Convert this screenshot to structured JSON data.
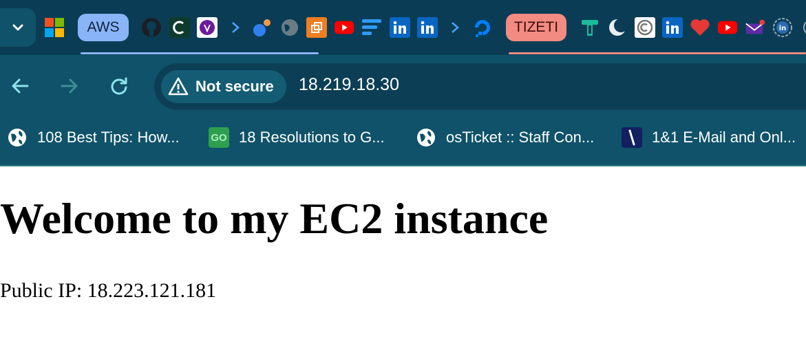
{
  "browser": {
    "tab_groups": [
      {
        "label": "AWS",
        "color": "#8ab4f8"
      },
      {
        "label": "TIZETI",
        "color": "#f28b82"
      }
    ],
    "tab_favicons": [
      "microsoft-icon",
      "github-icon",
      "c-app-icon",
      "purple-circle-icon",
      "chevron-icon",
      "blue-app-icon",
      "globe-icon",
      "orange-app-icon",
      "youtube-icon",
      "blue-lines-icon",
      "linkedin-icon",
      "linkedin-icon",
      "chevron-icon",
      "digitalocean-icon",
      "t-logo-icon",
      "crescent-icon",
      "copyright-icon",
      "linkedin-icon",
      "heart-icon",
      "youtube-icon",
      "mail-icon",
      "linkedin-outline-icon",
      "circle-icon"
    ],
    "security": {
      "label": "Not secure"
    },
    "url": "18.219.18.30",
    "bookmarks": [
      {
        "label": "108 Best Tips: How...",
        "icon": "globe-icon"
      },
      {
        "label": "18 Resolutions to G...",
        "icon": "go-icon"
      },
      {
        "label": "osTicket :: Staff Con...",
        "icon": "globe-icon"
      },
      {
        "label": "1&1 E-Mail and Onl...",
        "icon": "ionos-icon"
      }
    ],
    "go_icon_text": "GO"
  },
  "page": {
    "heading": "Welcome to my EC2 instance",
    "body_text": "Public IP: 18.223.121.181"
  }
}
